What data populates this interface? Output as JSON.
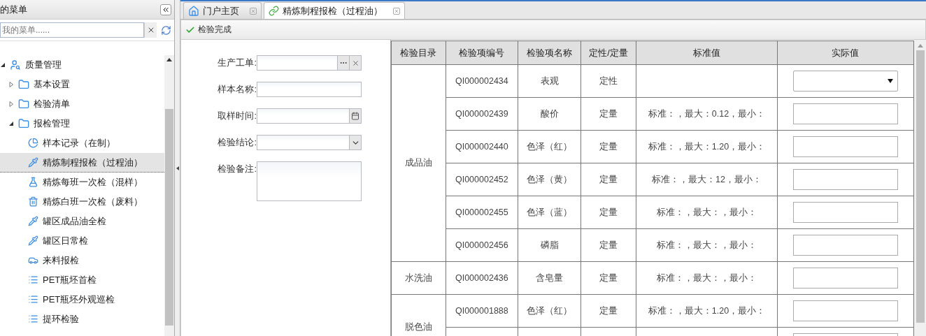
{
  "sidebar": {
    "title": "的菜单",
    "search": {
      "placeholder": "我的菜单......"
    },
    "tree": [
      {
        "label": "质量管理",
        "kind": "quality",
        "expanded": true,
        "selected": false,
        "children": [
          {
            "label": "基本设置",
            "kind": "folder",
            "expanded": false,
            "selected": false
          },
          {
            "label": "检验清单",
            "kind": "folder",
            "expanded": false,
            "selected": false
          },
          {
            "label": "报检管理",
            "kind": "folder",
            "expanded": true,
            "selected": false,
            "children": [
              {
                "label": "样本记录（在制）",
                "kind": "chart",
                "selected": false
              },
              {
                "label": "精炼制程报检（过程油）",
                "kind": "dropper",
                "selected": true
              },
              {
                "label": "精炼每班一次检（混样）",
                "kind": "flask",
                "selected": false
              },
              {
                "label": "精炼白班一次检（废料）",
                "kind": "bin",
                "selected": false
              },
              {
                "label": "罐区成品油全检",
                "kind": "dropper",
                "selected": false
              },
              {
                "label": "罐区日常检",
                "kind": "dropper",
                "selected": false
              },
              {
                "label": "来料报检",
                "kind": "car",
                "selected": false
              },
              {
                "label": "PET瓶坯首检",
                "kind": "list",
                "selected": false
              },
              {
                "label": "PET瓶坯外观巡检",
                "kind": "list",
                "selected": false
              },
              {
                "label": "提环检验",
                "kind": "list",
                "selected": false
              }
            ]
          }
        ]
      }
    ]
  },
  "tabs": [
    {
      "label": "门户主页",
      "kind": "home",
      "selected": false
    },
    {
      "label": "精炼制程报检（过程油）",
      "kind": "link",
      "selected": true
    }
  ],
  "toolbar": {
    "button": "检验完成"
  },
  "form": [
    {
      "label": "生产工单:",
      "kind": "picker"
    },
    {
      "label": "样本名称:",
      "kind": "text"
    },
    {
      "label": "取样时间:",
      "kind": "date"
    },
    {
      "label": "检验结论:",
      "kind": "select"
    },
    {
      "label": "检验备注:",
      "kind": "textarea"
    }
  ],
  "table": {
    "columns": [
      "检验目录",
      "检验项编号",
      "检验项名称",
      "定性/定量",
      "标准值",
      "实际值"
    ],
    "groups": [
      {
        "category": "成品油",
        "rows": [
          {
            "code": "QI000002434",
            "name": "表观",
            "type": "定性",
            "kind": "select"
          },
          {
            "code": "QI000002439",
            "name": "酸价",
            "type": "定量",
            "standard": "标准：，最大：0.12，最小：",
            "kind": "input"
          },
          {
            "code": "QI000002440",
            "name": "色泽（红）",
            "type": "定量",
            "standard": "标准：，最大：1.20，最小：",
            "kind": "input"
          },
          {
            "code": "QI000002452",
            "name": "色泽（黄）",
            "type": "定量",
            "standard": "标准：，最大：12，最小：",
            "kind": "input"
          },
          {
            "code": "QI000002455",
            "name": "色泽（蓝）",
            "type": "定量",
            "standard": "标准：，最大：，最小：",
            "kind": "input"
          },
          {
            "code": "QI000002456",
            "name": "磷脂",
            "type": "定量",
            "standard": "标准：，最大：，最小：",
            "kind": "input"
          }
        ]
      },
      {
        "category": "水洗油",
        "rows": [
          {
            "code": "QI000002436",
            "name": "含皂量",
            "type": "定量",
            "standard": "标准：，最大：，最小：",
            "kind": "input"
          }
        ]
      },
      {
        "category": "脱色油",
        "rows": [
          {
            "code": "QI000001888",
            "name": "色泽（红）",
            "type": "定量",
            "standard": "标准：，最大：1.20，最小：",
            "kind": "input"
          },
          {
            "kind": "input"
          }
        ]
      }
    ]
  }
}
